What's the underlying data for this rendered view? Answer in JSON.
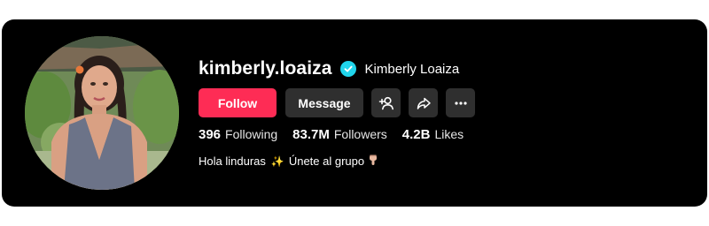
{
  "profile": {
    "username": "kimberly.loaiza",
    "display_name": "Kimberly Loaiza",
    "verified_icon": "verified-check-icon",
    "avatar_icon": "profile-photo"
  },
  "actions": {
    "follow_label": "Follow",
    "message_label": "Message",
    "add_friend_icon": "add-friend-icon",
    "share_icon": "share-icon",
    "more_icon": "more-options-icon"
  },
  "stats": {
    "following_count": "396",
    "following_label": "Following",
    "followers_count": "83.7M",
    "followers_label": "Followers",
    "likes_count": "4.2B",
    "likes_label": "Likes"
  },
  "bio": {
    "part1": "Hola linduras",
    "sparkle": "✨",
    "part2": "Únete al grupo",
    "pointing_icon": "pointing-down-emoji"
  },
  "colors": {
    "background": "#000000",
    "follow_button": "#fe2c55",
    "secondary_button": "#2f2f2f",
    "verified_badge": "#20d5ec",
    "text": "#ffffff"
  }
}
